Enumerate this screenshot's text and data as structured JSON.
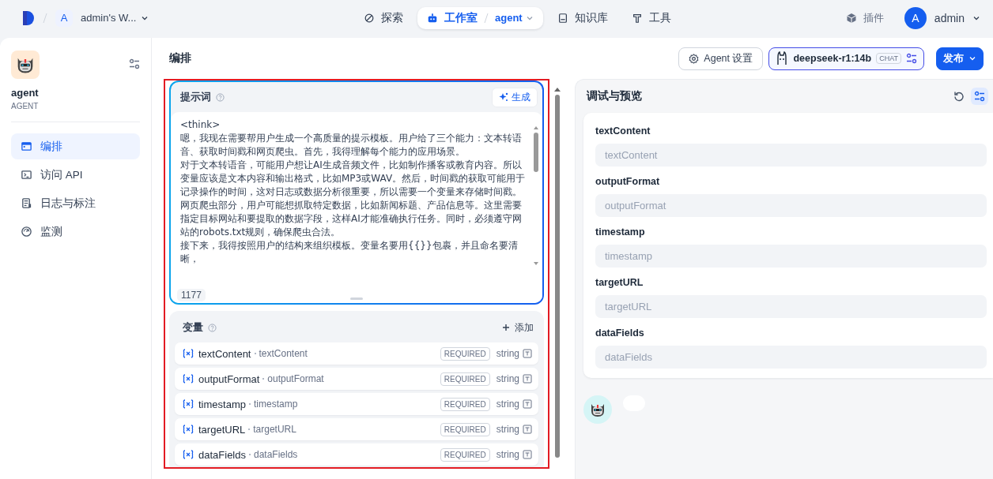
{
  "topbar": {
    "workspace_initial": "A",
    "workspace_name": "admin's W...",
    "nav": [
      {
        "label": "探索",
        "selected": false,
        "kind": "explore"
      },
      {
        "label": "工作室",
        "selected": true,
        "kind": "studio",
        "sub": "agent"
      },
      {
        "label": "知识库",
        "selected": false,
        "kind": "knowledge"
      },
      {
        "label": "工具",
        "selected": false,
        "kind": "tools"
      }
    ],
    "plugins": "插件",
    "user_initial": "A",
    "user_name": "admin"
  },
  "sidebar": {
    "app_name": "agent",
    "app_type": "AGENT",
    "items": [
      {
        "label": "编排",
        "selected": true,
        "kind": "layout"
      },
      {
        "label": "访问 API",
        "selected": false,
        "kind": "api"
      },
      {
        "label": "日志与标注",
        "selected": false,
        "kind": "logs"
      },
      {
        "label": "监测",
        "selected": false,
        "kind": "monitor"
      }
    ]
  },
  "editor": {
    "title": "编排",
    "settings_button": "Agent 设置",
    "model": {
      "name": "deepseek-r1:14b",
      "badge": "CHAT"
    },
    "publish_button": "发布",
    "prompt": {
      "title": "提示词",
      "generate_button": "生成",
      "char_count": "1177",
      "paragraphs": [
        "<think>",
        "嗯，我现在需要帮用户生成一个高质量的提示模板。用户给了三个能力：文本转语音、获取时间戳和网页爬虫。首先，我得理解每个能力的应用场景。",
        "对于文本转语音，可能用户想让AI生成音频文件，比如制作播客或教育内容。所以变量应该是文本内容和输出格式，比如MP3或WAV。然后，时间戳的获取可能用于记录操作的时间，这对日志或数据分析很重要，所以需要一个变量来存储时间戳。",
        "网页爬虫部分，用户可能想抓取特定数据，比如新闻标题、产品信息等。这里需要指定目标网站和要提取的数据字段，这样AI才能准确执行任务。同时，必须遵守网站的robots.txt规则，确保爬虫合法。",
        "接下来，我得按照用户的结构来组织模板。变量名要用{{}}包裹，并且命名要清晰，"
      ]
    },
    "variables": {
      "title": "变量",
      "add_button": "添加",
      "items": [
        {
          "name": "textContent",
          "label": "textContent",
          "tag": "REQUIRED",
          "type": "string"
        },
        {
          "name": "outputFormat",
          "label": "outputFormat",
          "tag": "REQUIRED",
          "type": "string"
        },
        {
          "name": "timestamp",
          "label": "timestamp",
          "tag": "REQUIRED",
          "type": "string"
        },
        {
          "name": "targetURL",
          "label": "targetURL",
          "tag": "REQUIRED",
          "type": "string"
        },
        {
          "name": "dataFields",
          "label": "dataFields",
          "tag": "REQUIRED",
          "type": "string"
        }
      ]
    }
  },
  "preview": {
    "title": "调试与预览",
    "fields": [
      {
        "label": "textContent",
        "placeholder": "textContent"
      },
      {
        "label": "outputFormat",
        "placeholder": "outputFormat"
      },
      {
        "label": "timestamp",
        "placeholder": "timestamp"
      },
      {
        "label": "targetURL",
        "placeholder": "targetURL"
      },
      {
        "label": "dataFields",
        "placeholder": "dataFields"
      }
    ]
  }
}
